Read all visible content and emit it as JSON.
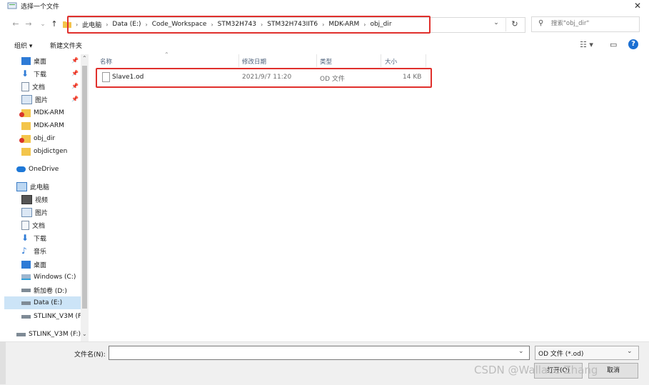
{
  "window": {
    "title": "选择一个文件",
    "close": "✕"
  },
  "nav": {
    "back": "←",
    "forward": "→",
    "down": "⌄",
    "up": "↑"
  },
  "address": {
    "segments": [
      "此电脑",
      "Data (E:)",
      "Code_Workspace",
      "STM32H743",
      "STM32H743IIT6",
      "MDK-ARM",
      "obj_dir"
    ]
  },
  "search": {
    "placeholder": "搜索\"obj_dir\""
  },
  "toolbar": {
    "organize": "组织 ▾",
    "new_folder": "新建文件夹"
  },
  "sidebar": {
    "items": [
      {
        "label": "桌面",
        "icon": "desktop-icon",
        "pinned": true
      },
      {
        "label": "下载",
        "icon": "download-icon",
        "pinned": true
      },
      {
        "label": "文档",
        "icon": "document-icon",
        "pinned": true
      },
      {
        "label": "图片",
        "icon": "picture-icon",
        "pinned": true
      },
      {
        "label": "MDK-ARM",
        "icon": "folder-icon"
      },
      {
        "label": "MDK-ARM",
        "icon": "folder-icon"
      },
      {
        "label": "obj_dir",
        "icon": "folder-icon"
      },
      {
        "label": "objdictgen",
        "icon": "folder-icon"
      },
      {
        "label": "OneDrive",
        "icon": "cloud-icon"
      },
      {
        "label": "此电脑",
        "icon": "computer-icon"
      },
      {
        "label": "视频",
        "icon": "video-icon"
      },
      {
        "label": "图片",
        "icon": "picture-icon"
      },
      {
        "label": "文档",
        "icon": "document-icon"
      },
      {
        "label": "下载",
        "icon": "download-icon"
      },
      {
        "label": "音乐",
        "icon": "music-icon"
      },
      {
        "label": "桌面",
        "icon": "desktop-icon"
      },
      {
        "label": "Windows (C:)",
        "icon": "drive-icon"
      },
      {
        "label": "新加卷 (D:)",
        "icon": "drive-icon"
      },
      {
        "label": "Data (E:)",
        "icon": "drive-icon"
      },
      {
        "label": "STLINK_V3M (F",
        "icon": "drive-icon"
      },
      {
        "label": "STLINK_V3M (F:)",
        "icon": "drive-icon"
      }
    ]
  },
  "columns": {
    "name": "名称",
    "modified": "修改日期",
    "type": "类型",
    "size": "大小"
  },
  "files": [
    {
      "name": "Slave1.od",
      "modified": "2021/9/7 11:20",
      "type": "OD 文件",
      "size": "14 KB"
    }
  ],
  "bottom": {
    "filename_label": "文件名(N):",
    "filename_value": "",
    "filetype": "OD 文件 (*.od)",
    "open": "打开(O)",
    "cancel": "取消"
  },
  "watermark": "CSDN @Wallace Zhang",
  "colors": {
    "highlight_red": "#e0302c",
    "selected_blue": "#cce4f7",
    "accent": "#1b6fd2"
  }
}
